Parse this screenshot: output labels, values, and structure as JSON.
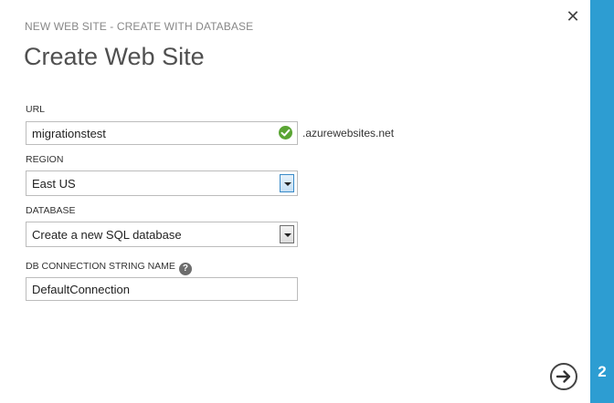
{
  "header": {
    "subtitle": "NEW WEB SITE - CREATE WITH DATABASE",
    "title": "Create Web Site"
  },
  "form": {
    "url": {
      "label": "URL",
      "value": "migrationstest",
      "suffix": ".azurewebsites.net",
      "status_icon": "check-circle-icon"
    },
    "region": {
      "label": "REGION",
      "value": "East US"
    },
    "database": {
      "label": "DATABASE",
      "value": "Create a new SQL database"
    },
    "db_connection": {
      "label": "DB CONNECTION STRING NAME",
      "help_glyph": "?",
      "value": "DefaultConnection"
    }
  },
  "footer": {
    "step_number": "2",
    "next_icon": "arrow-right-circle-icon"
  },
  "colors": {
    "accent": "#2d9dd2",
    "success": "#5aa534"
  }
}
